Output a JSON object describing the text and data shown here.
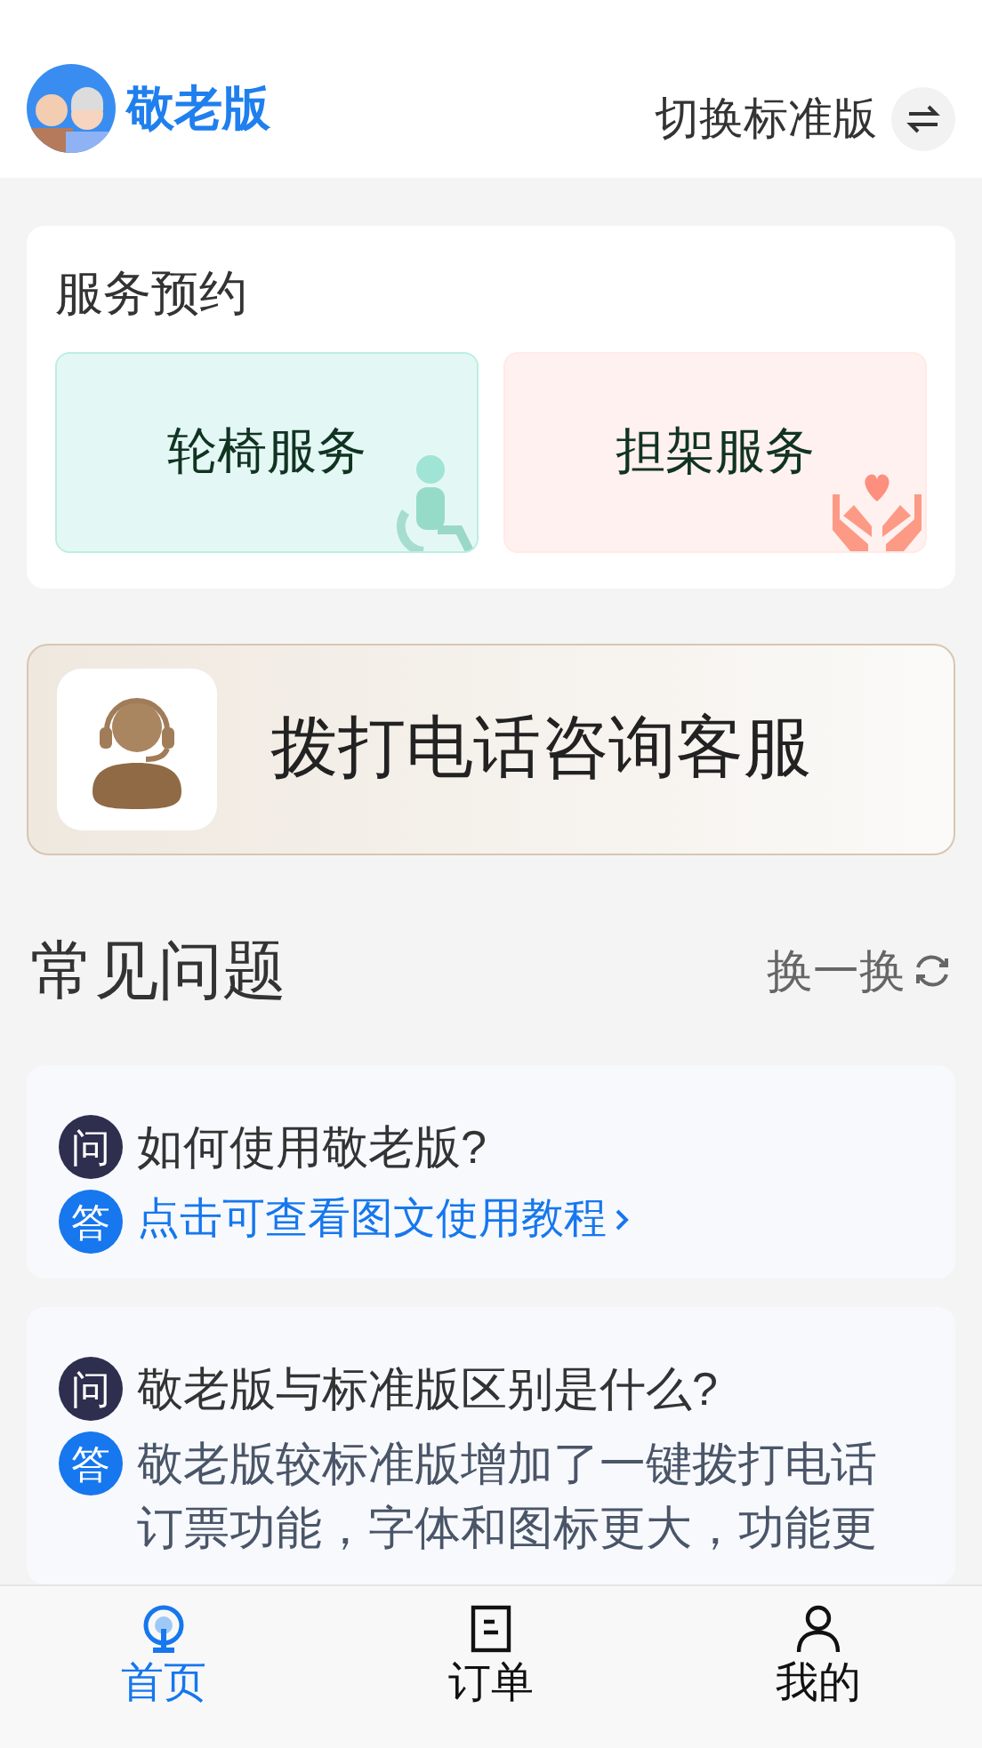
{
  "header": {
    "title": "敬老版",
    "switch_label": "切换标准版"
  },
  "services": {
    "title": "服务预约",
    "items": [
      {
        "kind": "wheelchair",
        "label": "轮椅服务"
      },
      {
        "kind": "stretcher",
        "label": "担架服务"
      }
    ]
  },
  "call_banner": {
    "label": "拨打电话咨询客服"
  },
  "faq": {
    "title": "常见问题",
    "refresh": "换一换",
    "items": [
      {
        "q_mark": "问",
        "question": "如何使用敬老版?",
        "a_mark": "答",
        "answer": "点击可查看图文使用教程",
        "kind": "link"
      },
      {
        "q_mark": "问",
        "question": "敬老版与标准版区别是什么?",
        "a_mark": "答",
        "answer": "敬老版较标准版增加了一键拨打电话订票功能，字体和图标更大，功能更",
        "kind": "text"
      }
    ]
  },
  "tabs": [
    {
      "kind": "home",
      "label": "首页",
      "selected": true
    },
    {
      "kind": "orders",
      "label": "订单",
      "selected": false
    },
    {
      "kind": "me",
      "label": "我的",
      "selected": false
    }
  ]
}
